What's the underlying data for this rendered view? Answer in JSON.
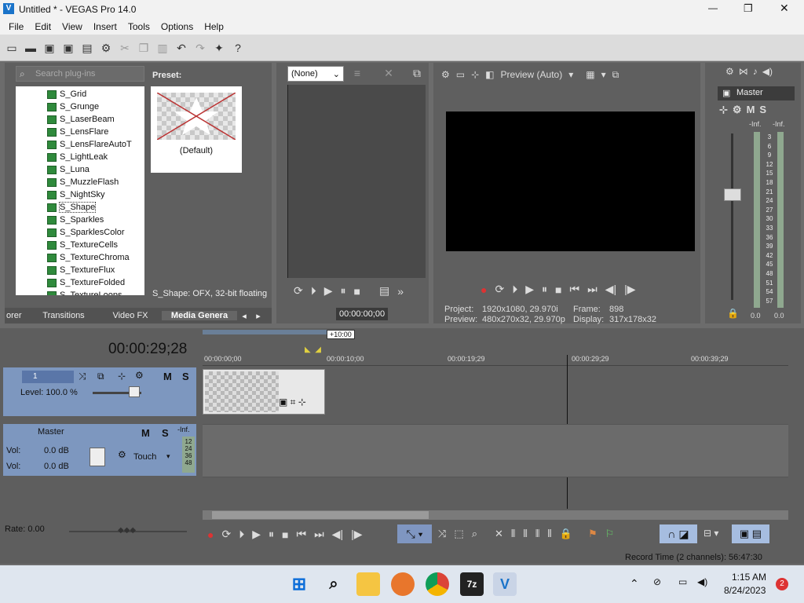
{
  "app": {
    "title": "Untitled * - VEGAS Pro 14.0",
    "min": "—",
    "max": "❐",
    "close": "✕"
  },
  "menu": [
    "File",
    "Edit",
    "View",
    "Insert",
    "Tools",
    "Options",
    "Help"
  ],
  "plugins": {
    "search_placeholder": "Search plug-ins",
    "items": [
      "S_Grid",
      "S_Grunge",
      "S_LaserBeam",
      "S_LensFlare",
      "S_LensFlareAutoT",
      "S_LightLeak",
      "S_Luna",
      "S_MuzzleFlash",
      "S_NightSky",
      "S_Shape",
      "S_Sparkles",
      "S_SparklesColor",
      "S_TextureCells",
      "S_TextureChroma",
      "S_TextureFlux",
      "S_TextureFolded",
      "S_TextureLoops"
    ],
    "selected": "S_Shape"
  },
  "preset": {
    "label": "Preset:",
    "item": "(Default)",
    "status": "S_Shape: OFX, 32-bit floating"
  },
  "tabs": [
    "orer",
    "Transitions",
    "Video FX",
    "Media Genera"
  ],
  "trimmer": {
    "select": "(None)",
    "timecode": "00:00:00;00"
  },
  "preview": {
    "mode": "Preview (Auto)",
    "project_label": "Project:",
    "project_val": "1920x1080, 29.970i",
    "preview_label": "Preview:",
    "preview_val": "480x270x32, 29.970p",
    "frame_label": "Frame:",
    "frame_val": "898",
    "display_label": "Display:",
    "display_val": "317x178x32"
  },
  "master": {
    "label": "Master",
    "m": "M",
    "s": "S",
    "inf1": "-Inf.",
    "inf2": "-Inf.",
    "scale": [
      "3",
      "6",
      "9",
      "12",
      "15",
      "18",
      "21",
      "24",
      "27",
      "30",
      "33",
      "36",
      "39",
      "42",
      "45",
      "48",
      "51",
      "54",
      "57"
    ],
    "val1": "0.0",
    "val2": "0.0"
  },
  "timeline": {
    "time": "00:00:29;28",
    "marker": "+10:00",
    "ruler": [
      "00:00:00;00",
      "00:00:10;00",
      "00:00:19;29",
      "00:00:29;29",
      "00:00:39;29"
    ]
  },
  "track1": {
    "num": "1",
    "level": "Level: 100.0 %",
    "m": "M",
    "s": "S"
  },
  "track2": {
    "name": "Master",
    "m": "M",
    "s": "S",
    "inf": "-Inf.",
    "vol1_label": "Vol:",
    "vol1": "0.0 dB",
    "vol2_label": "Vol:",
    "vol2": "0.0 dB",
    "touch": "Touch",
    "meter": [
      "12",
      "24",
      "36",
      "48"
    ]
  },
  "rate": "Rate: 0.00",
  "status": "Record Time (2 channels): 56:47:30",
  "clock": {
    "time": "1:15 AM",
    "date": "8/24/2023",
    "badge": "2"
  },
  "taskbar": {
    "app7z": "7z"
  }
}
